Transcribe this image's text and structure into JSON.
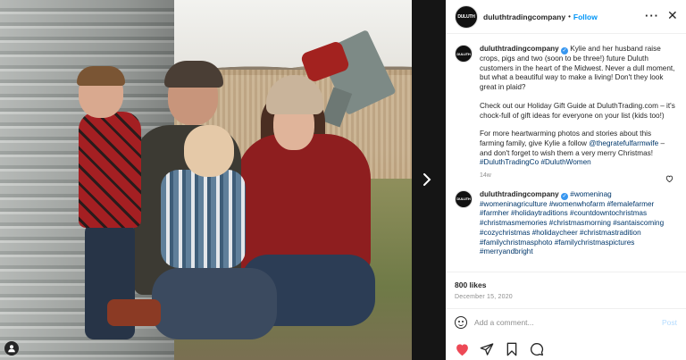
{
  "header": {
    "avatar_text": "DULUTH",
    "username": "duluthtradingcompany",
    "separator": "•",
    "follow_label": "Follow",
    "more_label": "···",
    "close_label": "✕"
  },
  "caption": {
    "username": "duluthtradingcompany",
    "p1": "Kylie and her husband raise crops, pigs and two (soon to be three!) future Duluth customers in the heart of the Midwest. Never a dull moment, but what a beautiful way to make a living! Don't they look great in plaid?",
    "p2": "Check out our Holiday Gift Guide at DuluthTrading.com – it's chock-full of gift ideas for everyone on your list (kids too!)",
    "p3_a": "For more heartwarming photos and stories about this farming family, give Kylie a follow",
    "p3_mention": "@thegratefulfarmwife",
    "p3_b": "– and don't forget to wish them a very merry Christmas!",
    "p3_tag1": "#DuluthTradingCo",
    "p3_tag2": "#DuluthWomen",
    "time": "14w"
  },
  "comment": {
    "username": "duluthtradingcompany",
    "hashtags": "#womeninag #womeninagriculture #womenwhofarm #femalefarmer #farmher #holidaytraditions #countdowntochristmas #christmasmemories #christmasmorning #santaiscoming #cozychristmas #holidaycheer #christmastradition #familychristmasphoto #familychristmaspictures #merryandbright"
  },
  "stats": {
    "likes": "800 likes",
    "date": "December 15, 2020"
  },
  "composer": {
    "placeholder": "Add a comment...",
    "post_label": "Post"
  },
  "icons": {
    "like": "heart-icon",
    "share": "paper-plane-icon",
    "save": "bookmark-icon",
    "comment": "speech-bubble-icon",
    "emoji": "smiley-icon",
    "next": "chevron-right-icon",
    "user_tag": "user-icon"
  },
  "colors": {
    "accent": "#0095f6",
    "like_red": "#ed4956",
    "link": "#00376b",
    "muted": "#8e8e8e"
  }
}
